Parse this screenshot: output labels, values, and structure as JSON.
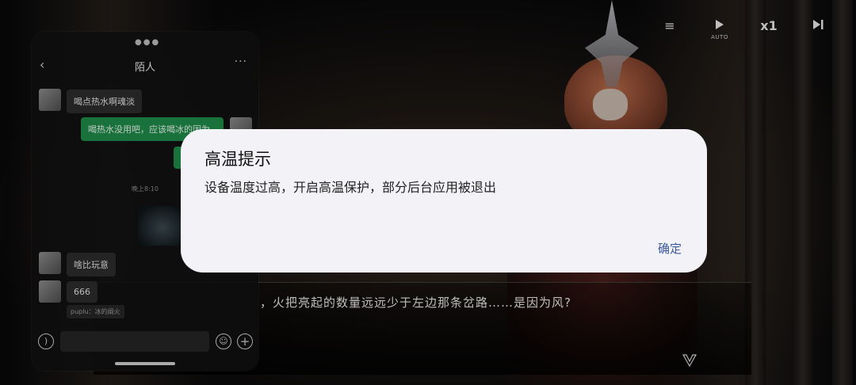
{
  "chat_window": {
    "title": "陌人",
    "messages": [
      {
        "dir": "in",
        "text": "喝点热水啊魂淡"
      },
      {
        "dir": "out",
        "text": "喝热水没用吧，应该喝冰的因为"
      },
      {
        "dir": "in",
        "text": "啥比玩意"
      },
      {
        "dir": "in",
        "text": "666"
      }
    ],
    "timestamp": "晚上8:10",
    "quote_text": "puplu：冰的阐火",
    "icons": {
      "back": "back-arrow-icon",
      "more": "more-icon",
      "voice": "voice-icon",
      "emoji": "emoji-icon",
      "plus": "plus-icon"
    }
  },
  "game": {
    "controls": {
      "log": "≡",
      "auto_label": "AUTO",
      "speed": "x1",
      "skip": "▶|"
    },
    "dialogue_text": "，火把亮起的数量远远少于左边那条岔路……是因为风?"
  },
  "dialog": {
    "title": "高温提示",
    "message": "设备温度过高，开启高温保护，部分后台应用被退出",
    "confirm_label": "确定",
    "accent_color": "#3a5a9a"
  }
}
